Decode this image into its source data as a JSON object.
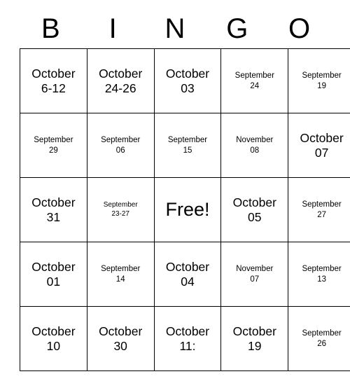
{
  "card": {
    "title": "BINGO",
    "header_letters": [
      "B",
      "I",
      "N",
      "G",
      "O"
    ],
    "rows": [
      [
        {
          "line1": "October",
          "line2": "6-12",
          "size": "lg"
        },
        {
          "line1": "October",
          "line2": "24-26",
          "size": "lg"
        },
        {
          "line1": "October",
          "line2": "03",
          "size": "lg"
        },
        {
          "line1": "September",
          "line2": "24",
          "size": "md"
        },
        {
          "line1": "September",
          "line2": "19",
          "size": "md"
        }
      ],
      [
        {
          "line1": "September",
          "line2": "29",
          "size": "md"
        },
        {
          "line1": "September",
          "line2": "06",
          "size": "md"
        },
        {
          "line1": "September",
          "line2": "15",
          "size": "md"
        },
        {
          "line1": "November",
          "line2": "08",
          "size": "md"
        },
        {
          "line1": "October",
          "line2": "07",
          "size": "lg"
        }
      ],
      [
        {
          "line1": "October",
          "line2": "31",
          "size": "lg"
        },
        {
          "line1": "September",
          "line2": "23-27",
          "size": "sm"
        },
        {
          "line1": "Free!",
          "line2": "",
          "size": "free"
        },
        {
          "line1": "October",
          "line2": "05",
          "size": "lg"
        },
        {
          "line1": "September",
          "line2": "27",
          "size": "md"
        }
      ],
      [
        {
          "line1": "October",
          "line2": "01",
          "size": "lg"
        },
        {
          "line1": "September",
          "line2": "14",
          "size": "md"
        },
        {
          "line1": "October",
          "line2": "04",
          "size": "lg"
        },
        {
          "line1": "November",
          "line2": "07",
          "size": "md"
        },
        {
          "line1": "September",
          "line2": "13",
          "size": "md"
        }
      ],
      [
        {
          "line1": "October",
          "line2": "10",
          "size": "lg"
        },
        {
          "line1": "October",
          "line2": "30",
          "size": "lg"
        },
        {
          "line1": "October",
          "line2": "11:",
          "size": "lg"
        },
        {
          "line1": "October",
          "line2": "19",
          "size": "lg"
        },
        {
          "line1": "September",
          "line2": "26",
          "size": "md"
        }
      ]
    ],
    "free_space": {
      "row": 2,
      "col": 2,
      "label": "Free!"
    },
    "colors": {
      "background": "#ffffff",
      "text": "#000000",
      "grid_line": "#000000"
    }
  }
}
